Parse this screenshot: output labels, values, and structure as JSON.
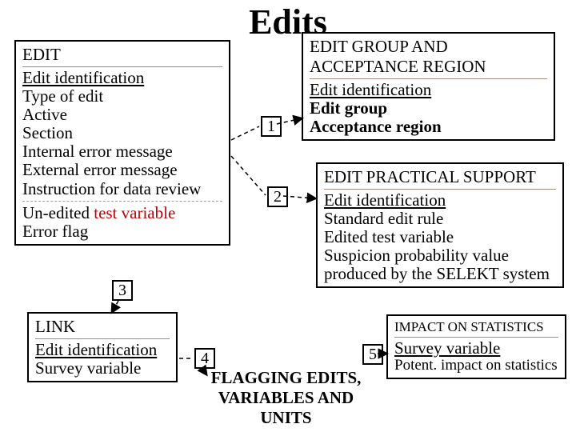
{
  "title": "Edits",
  "edit_box": {
    "header": "EDIT",
    "lines": [
      "Edit identification",
      "Type of edit",
      "Active",
      "Section",
      "Internal error message",
      "External error message",
      "Instruction for data review"
    ],
    "after_sep_prefix": "Un-edited ",
    "after_sep_red": "test variable",
    "after_sep_line2": "Error flag"
  },
  "group_box": {
    "header": "EDIT GROUP AND ACCEPTANCE REGION",
    "lines": [
      "Edit identification",
      "Edit group",
      "Acceptance region"
    ]
  },
  "practical_box": {
    "header": "EDIT PRACTICAL SUPPORT",
    "lines": [
      "Edit identification",
      "Standard edit rule",
      "Edited test variable",
      "Suspicion probability value produced by the SELEKT system"
    ]
  },
  "link_box": {
    "header": "LINK",
    "lines": [
      "Edit identification",
      "Survey variable"
    ]
  },
  "impact_box": {
    "header": "IMPACT ON STATISTICS",
    "lines": [
      "Survey variable",
      "Potent. impact on statistics"
    ]
  },
  "flag_caption": "FLAGGING EDITS, VARIABLES AND UNITS",
  "nums": {
    "n1": "1",
    "n2": "2",
    "n3": "3",
    "n4": "4",
    "n5": "5"
  }
}
